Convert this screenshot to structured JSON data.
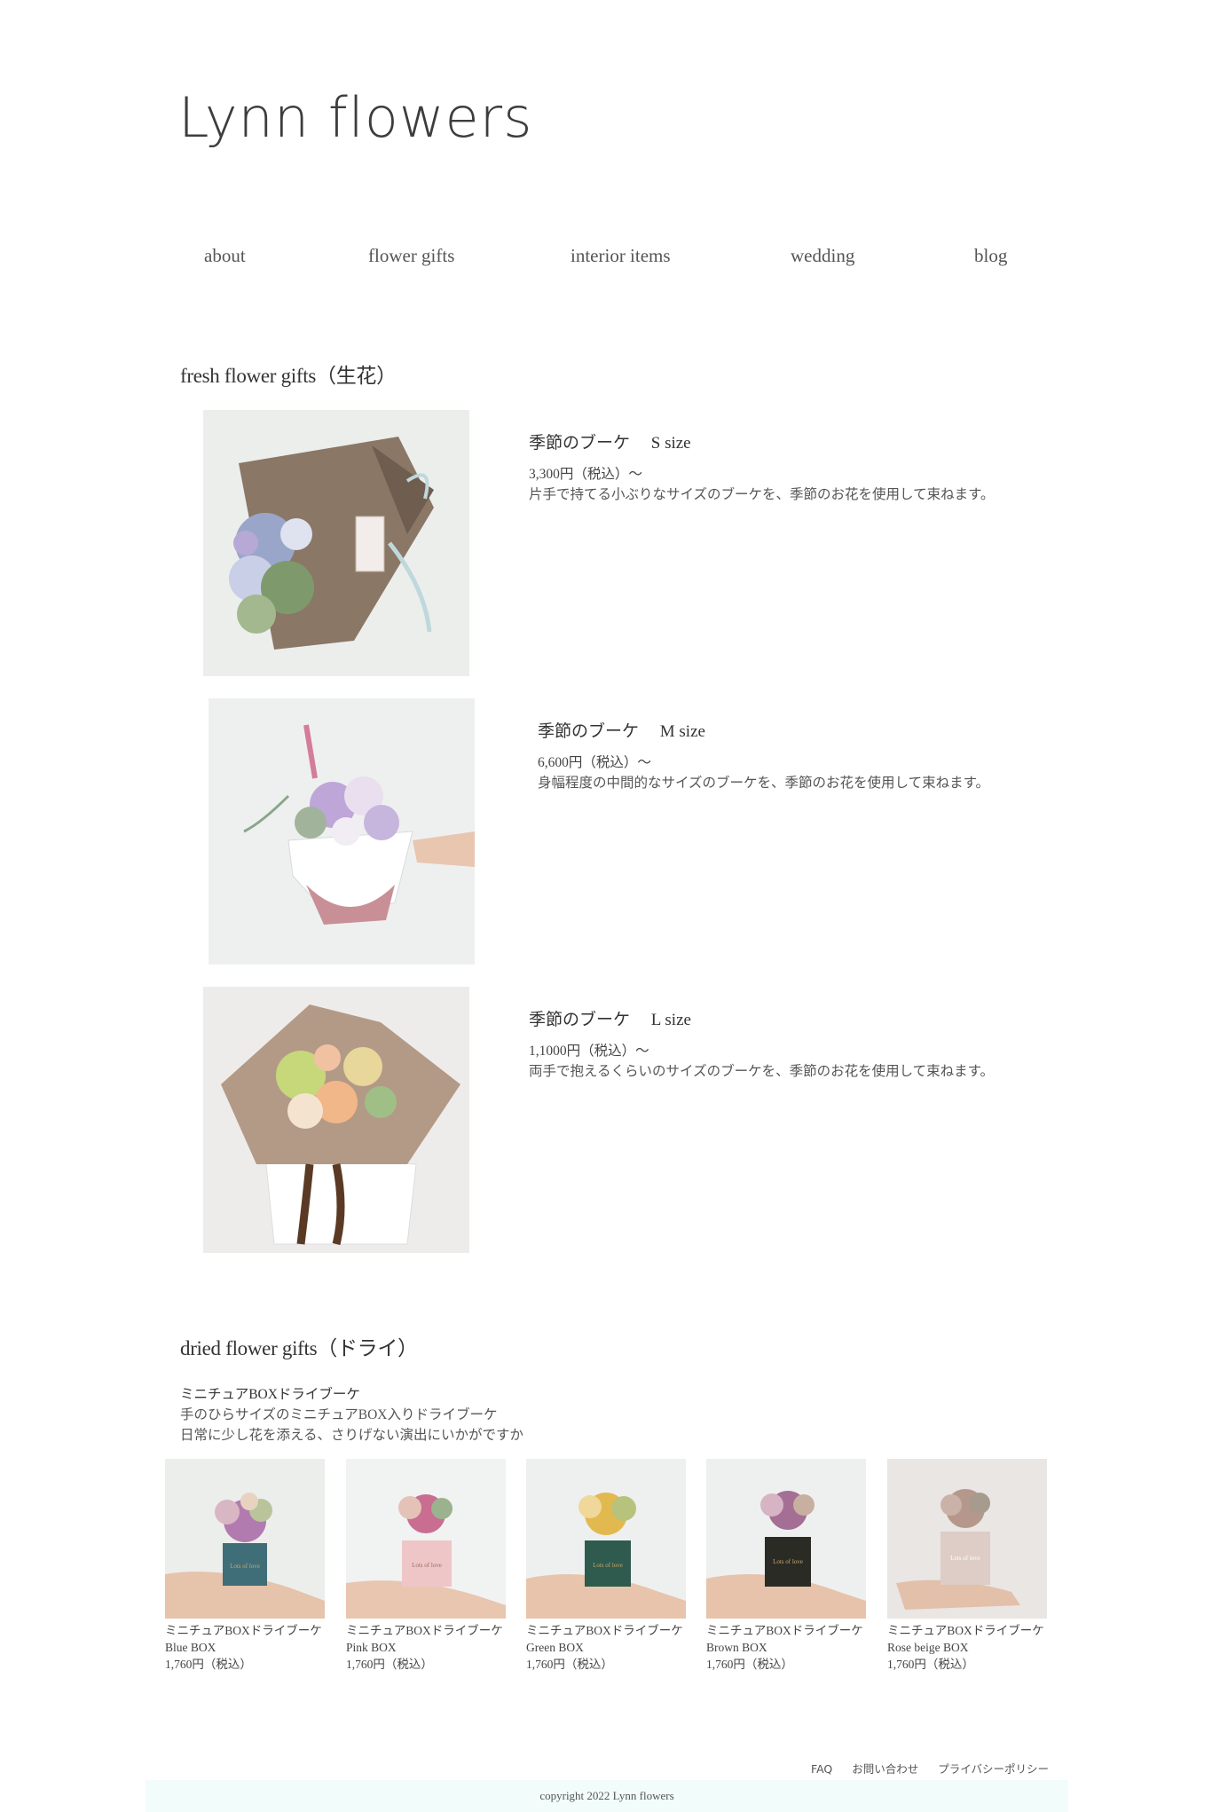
{
  "site": {
    "logo": "Lynn flowers"
  },
  "nav": [
    {
      "label": "about"
    },
    {
      "label": "flower gifts"
    },
    {
      "label": "interior items"
    },
    {
      "label": "wedding"
    },
    {
      "label": "blog"
    }
  ],
  "fresh": {
    "title": "fresh flower gifts（生花）",
    "products": [
      {
        "name": "季節のブーケ　 S size",
        "price": "3,300円（税込）～",
        "desc": "片手で持てる小ぶりなサイズのブーケを、季節のお花を使用して束ねます。"
      },
      {
        "name": "季節のブーケ　 M size",
        "price": "6,600円（税込）～",
        "desc": "身幅程度の中間的なサイズのブーケを、季節のお花を使用して束ねます。"
      },
      {
        "name": "季節のブーケ　 L size",
        "price": "1,1000円（税込）～",
        "desc": "両手で抱えるくらいのサイズのブーケを、季節のお花を使用して束ねます。"
      }
    ]
  },
  "dried": {
    "title": "dried flower gifts（ドライ）",
    "lead": "ミニチュアBOXドライブーケ",
    "line1": "手のひらサイズのミニチュアBOX入りドライブーケ",
    "line2": "日常に少し花を添える、さりげない演出にいかがですか",
    "items": [
      {
        "name": "ミニチュアBOXドライブーケ",
        "variant": "Blue BOX",
        "price": "1,760円（税込）"
      },
      {
        "name": "ミニチュアBOXドライブーケ",
        "variant": "Pink BOX",
        "price": "1,760円（税込）"
      },
      {
        "name": "ミニチュアBOXドライブーケ",
        "variant": "Green BOX",
        "price": "1,760円（税込）"
      },
      {
        "name": "ミニチュアBOXドライブーケ",
        "variant": "Brown BOX",
        "price": "1,760円（税込）"
      },
      {
        "name": "ミニチュアBOXドライブーケ",
        "variant": "Rose beige BOX",
        "price": "1,760円（税込）"
      }
    ],
    "box_text": "Lots of love"
  },
  "footer": {
    "links": [
      {
        "label": "FAQ"
      },
      {
        "label": "お問い合わせ"
      },
      {
        "label": "プライバシーポリシー"
      }
    ],
    "copyright": "copyright 2022 Lynn flowers"
  },
  "colors": {
    "copyright_bg": "#f2fcfb",
    "text": "#4a4a4a"
  }
}
